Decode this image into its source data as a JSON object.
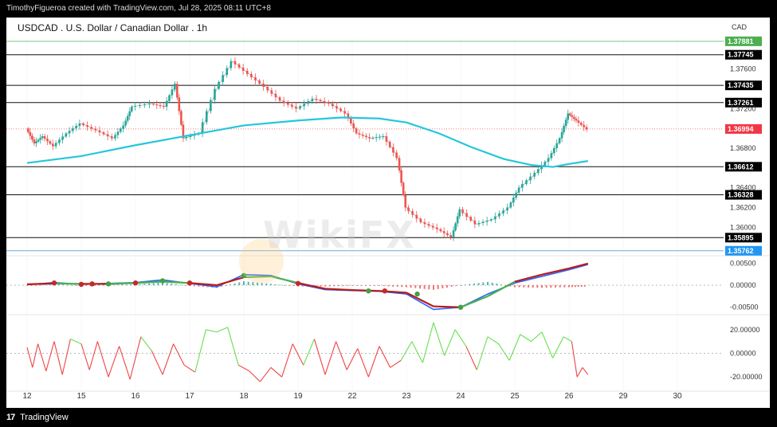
{
  "header": {
    "attribution": "TimothyFigueroa created with TradingView.com, Jul 28, 2025 08:11 UTC+8"
  },
  "footer": {
    "logo_mark": "17",
    "logo_text": "TradingView"
  },
  "watermark": {
    "text": "WikiFX"
  },
  "colors": {
    "up": "#26a69a",
    "down": "#ef5350",
    "ma": "#26c6da",
    "macd_line": "#2962ff",
    "signal_line": "#4caf50",
    "rsi_up": "#66e04f",
    "rsi_down": "#ef4444",
    "level_green": "#7cc47c",
    "level_blue": "#6fa8dc"
  },
  "chart_data": {
    "type": "line",
    "title": "USDCAD . U.S. Dollar / Canadian Dollar . 1h",
    "currency": "CAD",
    "x_ticks": [
      {
        "label": "12",
        "pos": 0.0
      },
      {
        "label": "15",
        "pos": 1.0
      },
      {
        "label": "16",
        "pos": 2.0
      },
      {
        "label": "17",
        "pos": 3.0
      },
      {
        "label": "18",
        "pos": 4.0
      },
      {
        "label": "19",
        "pos": 5.0
      },
      {
        "label": "22",
        "pos": 6.0
      },
      {
        "label": "23",
        "pos": 7.0
      },
      {
        "label": "24",
        "pos": 8.0
      },
      {
        "label": "25",
        "pos": 9.0
      },
      {
        "label": "26",
        "pos": 10.0
      },
      {
        "label": "29",
        "pos": 11.0
      },
      {
        "label": "30",
        "pos": 12.0
      }
    ],
    "price_panel": {
      "ylim": [
        1.3572,
        1.3792
      ],
      "y_ticks": [
        "1.37600",
        "1.37200",
        "1.36800",
        "1.36400",
        "1.36200",
        "1.36000"
      ],
      "levels": [
        {
          "value": 1.37881,
          "label": "1.37881",
          "color": "green"
        },
        {
          "value": 1.37745,
          "label": "1.37745",
          "color": "black"
        },
        {
          "value": 1.37435,
          "label": "1.37435",
          "color": "black"
        },
        {
          "value": 1.37261,
          "label": "1.37261",
          "color": "black"
        },
        {
          "value": 1.36612,
          "label": "1.36612",
          "color": "black"
        },
        {
          "value": 1.36328,
          "label": "1.36328",
          "color": "black"
        },
        {
          "value": 1.35895,
          "label": "1.35895",
          "color": "black"
        },
        {
          "value": 1.35762,
          "label": "1.35762",
          "color": "blue"
        }
      ],
      "last_price": {
        "value": 1.36994,
        "label": "1.36994"
      },
      "price_path": [
        [
          0.0,
          1.37
        ],
        [
          0.15,
          1.3685
        ],
        [
          0.3,
          1.3692
        ],
        [
          0.5,
          1.3682
        ],
        [
          0.75,
          1.3695
        ],
        [
          1.0,
          1.3705
        ],
        [
          1.3,
          1.3698
        ],
        [
          1.6,
          1.369
        ],
        [
          1.8,
          1.3703
        ],
        [
          1.95,
          1.3722
        ],
        [
          2.3,
          1.3725
        ],
        [
          2.55,
          1.3722
        ],
        [
          2.75,
          1.3745
        ],
        [
          2.9,
          1.369
        ],
        [
          3.2,
          1.3695
        ],
        [
          3.5,
          1.374
        ],
        [
          3.8,
          1.3768
        ],
        [
          4.1,
          1.3755
        ],
        [
          4.4,
          1.3742
        ],
        [
          4.7,
          1.3728
        ],
        [
          5.0,
          1.372
        ],
        [
          5.3,
          1.373
        ],
        [
          5.6,
          1.3725
        ],
        [
          5.9,
          1.3715
        ],
        [
          6.1,
          1.3695
        ],
        [
          6.35,
          1.369
        ],
        [
          6.6,
          1.3692
        ],
        [
          6.85,
          1.367
        ],
        [
          7.0,
          1.362
        ],
        [
          7.3,
          1.3605
        ],
        [
          7.6,
          1.3598
        ],
        [
          7.85,
          1.359
        ],
        [
          8.0,
          1.3618
        ],
        [
          8.3,
          1.3603
        ],
        [
          8.6,
          1.3608
        ],
        [
          8.9,
          1.362
        ],
        [
          9.1,
          1.364
        ],
        [
          9.4,
          1.3655
        ],
        [
          9.65,
          1.367
        ],
        [
          9.85,
          1.369
        ],
        [
          10.0,
          1.3715
        ],
        [
          10.15,
          1.3708
        ],
        [
          10.35,
          1.3699
        ]
      ],
      "ma_path": [
        [
          0.0,
          1.3665
        ],
        [
          1.0,
          1.3672
        ],
        [
          2.0,
          1.3683
        ],
        [
          3.0,
          1.3693
        ],
        [
          4.0,
          1.3703
        ],
        [
          5.0,
          1.3708
        ],
        [
          5.8,
          1.3711
        ],
        [
          6.5,
          1.371
        ],
        [
          7.0,
          1.3706
        ],
        [
          7.6,
          1.3695
        ],
        [
          8.2,
          1.3681
        ],
        [
          8.8,
          1.3669
        ],
        [
          9.3,
          1.3663
        ],
        [
          9.7,
          1.3661
        ],
        [
          10.0,
          1.3664
        ],
        [
          10.35,
          1.3667
        ]
      ]
    },
    "macd_panel": {
      "ylim": [
        -0.0065,
        0.0065
      ],
      "y_ticks": [
        "0.00500",
        "0.00000",
        "-0.00500"
      ],
      "macd_path": [
        [
          0.0,
          0.0001
        ],
        [
          0.5,
          0.0006
        ],
        [
          1.0,
          0.0002
        ],
        [
          1.5,
          0.0004
        ],
        [
          2.0,
          0.0006
        ],
        [
          2.5,
          0.0012
        ],
        [
          3.0,
          0.0004
        ],
        [
          3.5,
          -0.0004
        ],
        [
          4.0,
          0.0024
        ],
        [
          4.5,
          0.0022
        ],
        [
          5.0,
          0.0003
        ],
        [
          5.5,
          -0.001
        ],
        [
          6.0,
          -0.0012
        ],
        [
          6.5,
          -0.0014
        ],
        [
          7.0,
          -0.002
        ],
        [
          7.5,
          -0.0055
        ],
        [
          8.0,
          -0.005
        ],
        [
          8.5,
          -0.002
        ],
        [
          9.0,
          0.0005
        ],
        [
          9.5,
          0.002
        ],
        [
          10.0,
          0.0035
        ],
        [
          10.35,
          0.0047
        ]
      ],
      "signal_path": [
        [
          0.0,
          0.0002
        ],
        [
          0.5,
          0.0004
        ],
        [
          1.0,
          0.0003
        ],
        [
          1.5,
          0.0003
        ],
        [
          2.0,
          0.0005
        ],
        [
          2.5,
          0.0008
        ],
        [
          3.0,
          0.0005
        ],
        [
          3.5,
          0.0
        ],
        [
          4.0,
          0.0018
        ],
        [
          4.5,
          0.002
        ],
        [
          5.0,
          0.0005
        ],
        [
          5.5,
          -0.0008
        ],
        [
          6.0,
          -0.0011
        ],
        [
          6.5,
          -0.0013
        ],
        [
          7.0,
          -0.0017
        ],
        [
          7.5,
          -0.0048
        ],
        [
          8.0,
          -0.005
        ],
        [
          8.5,
          -0.0025
        ],
        [
          9.0,
          0.0008
        ],
        [
          9.5,
          0.0024
        ],
        [
          10.0,
          0.0038
        ],
        [
          10.35,
          0.0049
        ]
      ],
      "cross_points": [
        [
          0.5,
          0.0005,
          "down"
        ],
        [
          1.0,
          0.0002,
          "down"
        ],
        [
          1.2,
          0.0003,
          "down"
        ],
        [
          1.5,
          0.0003,
          "up"
        ],
        [
          2.0,
          0.0005,
          "down"
        ],
        [
          2.5,
          0.001,
          "up"
        ],
        [
          3.0,
          0.0005,
          "down"
        ],
        [
          4.0,
          0.0022,
          "up"
        ],
        [
          5.0,
          0.0004,
          "down"
        ],
        [
          6.3,
          -0.0013,
          "up"
        ],
        [
          6.6,
          -0.0013,
          "down"
        ],
        [
          7.2,
          -0.002,
          "up"
        ],
        [
          8.0,
          -0.005,
          "up"
        ]
      ]
    },
    "rsi_panel": {
      "ylim": [
        -30,
        32
      ],
      "y_ticks": [
        "20.00000",
        "0.00000",
        "-20.00000"
      ],
      "line_path": [
        [
          0.0,
          5
        ],
        [
          0.1,
          -12
        ],
        [
          0.2,
          8
        ],
        [
          0.35,
          -15
        ],
        [
          0.5,
          10
        ],
        [
          0.65,
          -18
        ],
        [
          0.8,
          12
        ],
        [
          1.0,
          8
        ],
        [
          1.15,
          -14
        ],
        [
          1.3,
          10
        ],
        [
          1.5,
          -20
        ],
        [
          1.7,
          6
        ],
        [
          1.9,
          -22
        ],
        [
          2.1,
          14
        ],
        [
          2.3,
          2
        ],
        [
          2.5,
          -18
        ],
        [
          2.7,
          8
        ],
        [
          2.9,
          -10
        ],
        [
          3.1,
          -16
        ],
        [
          3.3,
          20
        ],
        [
          3.5,
          18
        ],
        [
          3.7,
          22
        ],
        [
          3.9,
          -10
        ],
        [
          4.1,
          -15
        ],
        [
          4.3,
          -24
        ],
        [
          4.5,
          -12
        ],
        [
          4.7,
          -20
        ],
        [
          4.9,
          8
        ],
        [
          5.1,
          -10
        ],
        [
          5.3,
          12
        ],
        [
          5.5,
          -18
        ],
        [
          5.7,
          10
        ],
        [
          5.9,
          -14
        ],
        [
          6.1,
          4
        ],
        [
          6.3,
          -20
        ],
        [
          6.5,
          6
        ],
        [
          6.7,
          -12
        ],
        [
          6.9,
          -6
        ],
        [
          7.1,
          10
        ],
        [
          7.3,
          -8
        ],
        [
          7.5,
          26
        ],
        [
          7.7,
          -2
        ],
        [
          7.9,
          20
        ],
        [
          8.1,
          6
        ],
        [
          8.3,
          -14
        ],
        [
          8.5,
          14
        ],
        [
          8.7,
          8
        ],
        [
          8.9,
          -6
        ],
        [
          9.1,
          16
        ],
        [
          9.3,
          10
        ],
        [
          9.5,
          18
        ],
        [
          9.7,
          -4
        ],
        [
          9.9,
          14
        ],
        [
          10.05,
          10
        ],
        [
          10.15,
          -20
        ],
        [
          10.25,
          -12
        ],
        [
          10.35,
          -18
        ]
      ]
    }
  }
}
